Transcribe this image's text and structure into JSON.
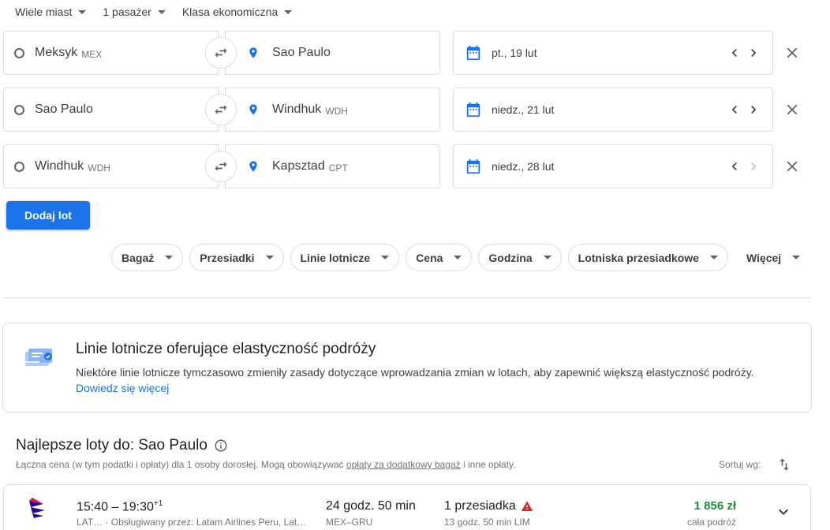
{
  "trip_options": {
    "trip_type": "Wiele miast",
    "passengers": "1 pasażer",
    "cabin_class": "Klasa ekonomiczna"
  },
  "legs": [
    {
      "from": "Meksyk",
      "from_code": "MEX",
      "to": "Sao Paulo",
      "to_code": "",
      "date": "pt., 19 lut"
    },
    {
      "from": "Sao Paulo",
      "from_code": "",
      "to": "Windhuk",
      "to_code": "WDH",
      "date": "niedz., 21 lut"
    },
    {
      "from": "Windhuk",
      "from_code": "WDH",
      "to": "Kapsztad",
      "to_code": "CPT",
      "date": "niedz., 28 lut"
    }
  ],
  "add_flight_label": "Dodaj lot",
  "filters": [
    "Bagaż",
    "Przesiadki",
    "Linie lotnicze",
    "Cena",
    "Godzina",
    "Lotniska przesiadkowe"
  ],
  "more_filters_label": "Więcej",
  "notice": {
    "title": "Linie lotnicze oferujące elastyczność podróży",
    "body": "Niektóre linie lotnicze tymczasowo zmieniły zasady dotyczące wprowadzania zmian w lotach, aby zapewnić większą elastyczność podróży.",
    "link": "Dowiedz się więcej"
  },
  "results": {
    "title": "Najlepsze loty do: Sao Paulo",
    "subtitle_before": "Łączna cena (w tym podatki i opłaty) dla 1 osoby dorosłej. Mogą obowiązywać ",
    "subtitle_link": "opłaty za dodatkowy bagaż",
    "subtitle_after": " i inne opłaty.",
    "sort_label": "Sortuj wg:"
  },
  "flights": [
    {
      "times": "15:40 – 19:30",
      "day_offset": "+1",
      "airline": "LAT…  ·  Obsługiwany przez: Latam Airlines Peru, Lat…",
      "duration": "24 godz. 50 min",
      "route": "MEX–GRU",
      "stops": "1 przesiadka",
      "layover": "13 godz. 50 min LIM",
      "price": "1 856 zł",
      "price_note": "cała podróż"
    }
  ],
  "colors": {
    "accent": "#1a73e8",
    "price_green": "#1e8e3e",
    "warning_red": "#d93025",
    "latam_logo": "#2b0a8e",
    "latam_logo_accent": "#e8114b"
  }
}
